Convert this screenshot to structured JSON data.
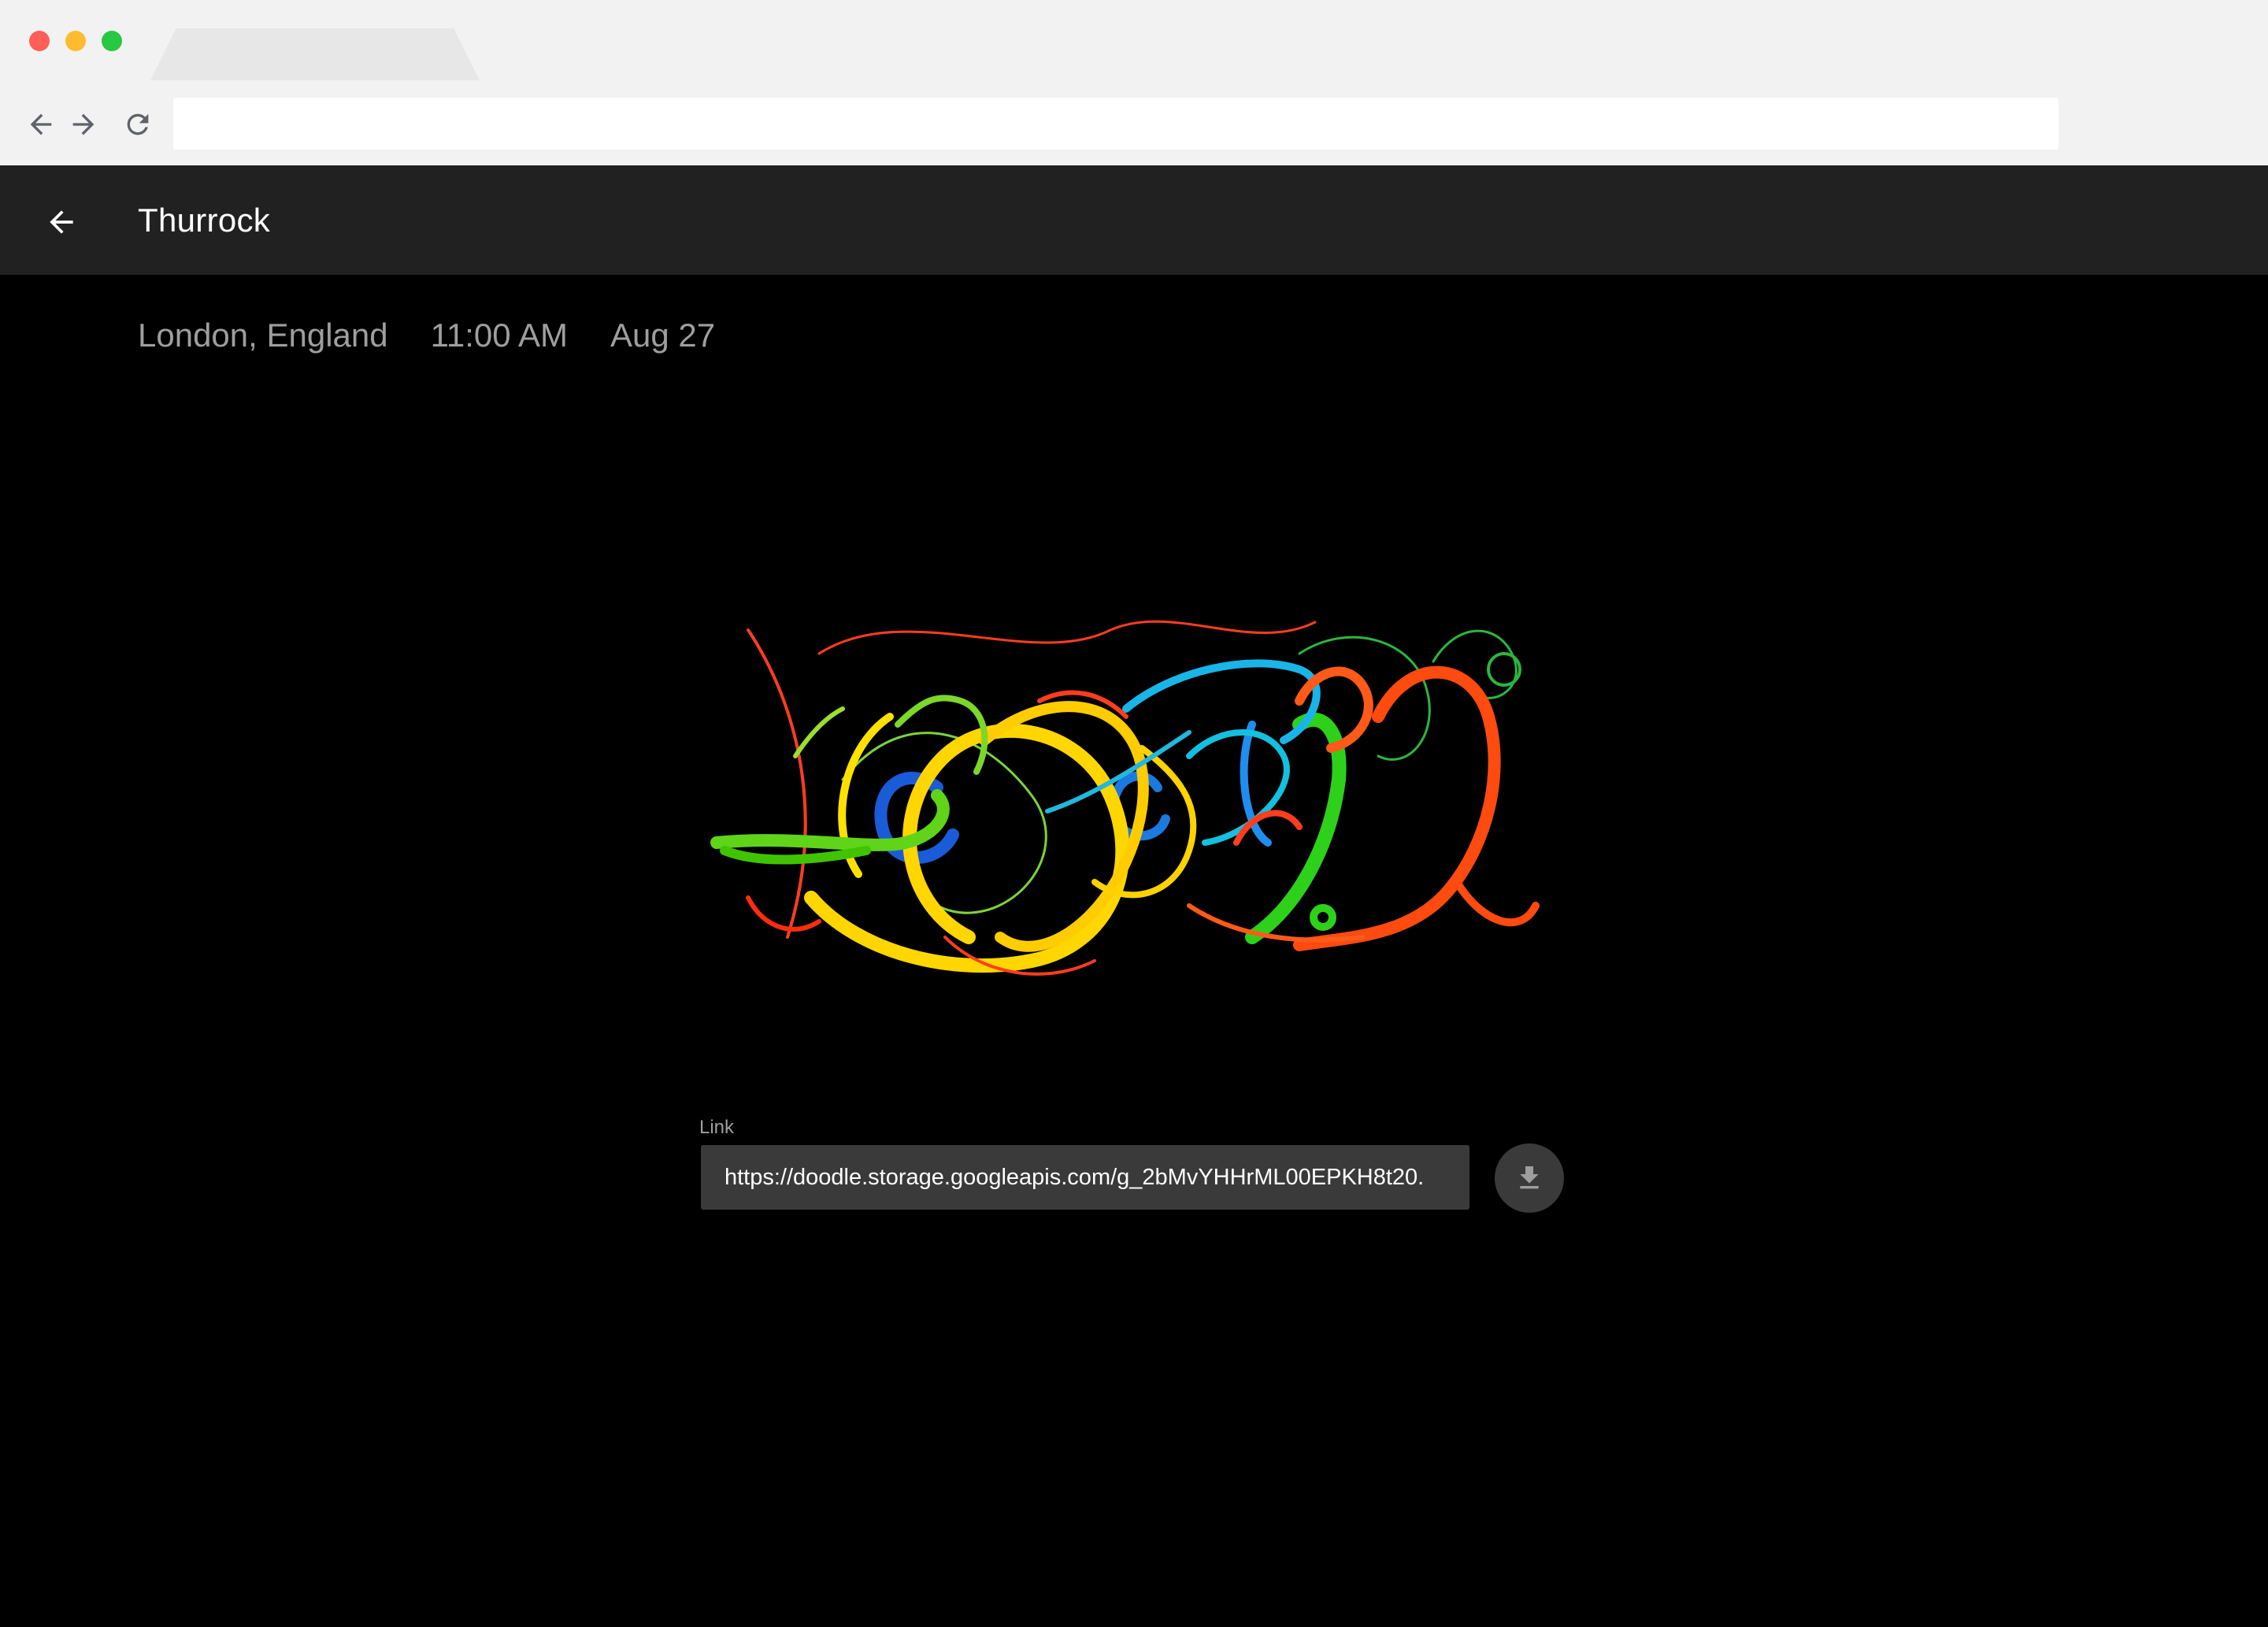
{
  "browser": {
    "address": "",
    "icons": {
      "back": "arrow-left-icon",
      "forward": "arrow-right-icon",
      "reload": "reload-icon"
    }
  },
  "header": {
    "title": "Thurrock",
    "back_icon": "arrow-left-icon"
  },
  "meta": {
    "location": "London, England",
    "time": "11:00 AM",
    "date": "Aug 27"
  },
  "link": {
    "label": "Link",
    "value": "https://doodle.storage.googleapis.com/g_2bMvYHHrML00EPKH8t20.",
    "download_icon": "download-icon"
  },
  "colors": {
    "header_bg": "#212121",
    "page_bg": "#000000",
    "input_bg": "#3a3a3a",
    "meta_text": "#9e9e9e"
  }
}
